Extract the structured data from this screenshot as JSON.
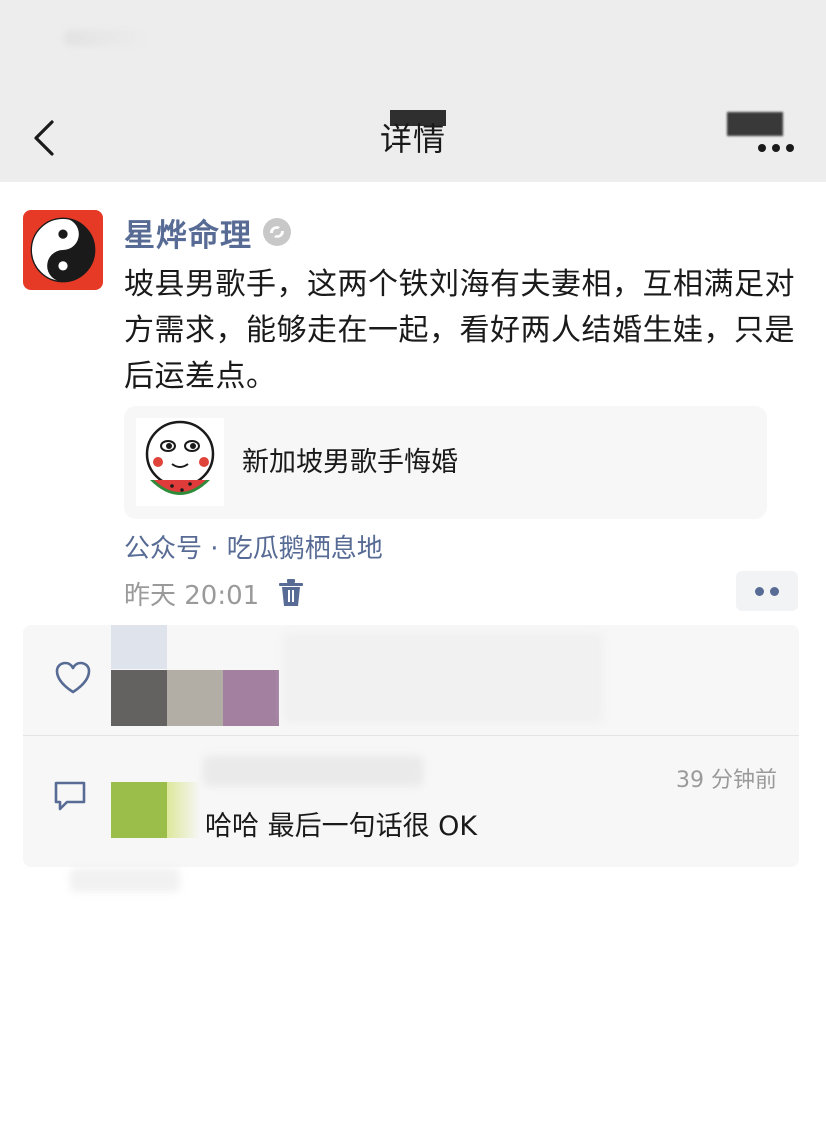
{
  "header": {
    "title": "详情",
    "back_icon": "chevron-left-icon",
    "more_icon": "more-dots-icon"
  },
  "post": {
    "author": "星烨命理",
    "avatar_icon": "yin-yang-icon",
    "verified_icon": "verified-badge-icon",
    "text": "坡县男歌手，这两个铁刘海有夫妻相，互相满足对方需求，能够走在一起，看好两人结婚生娃，只是后运差点。",
    "share_card": {
      "title": "新加坡男歌手悔婚",
      "thumb_icon": "watermelon-face-icon"
    },
    "source": "公众号 · 吃瓜鹅栖息地",
    "time": "昨天 20:01",
    "delete_icon": "trash-icon",
    "action_icon": "two-dots-icon"
  },
  "likes": {
    "icon": "heart-icon",
    "avatar_colors": [
      "#dfe4ec",
      "#636260",
      "#b2aea6",
      "#a380a0"
    ]
  },
  "comment": {
    "icon": "comment-icon",
    "time": "39 分钟前",
    "text": "哈哈  最后一句话很 OK",
    "avatar_colors": [
      "#9bbd4a",
      "#dde89b"
    ]
  },
  "colors": {
    "link": "#576b95",
    "avatar_bg": "#e63a27",
    "panel_bg": "#f7f7f7",
    "header_bg": "#ededed"
  }
}
